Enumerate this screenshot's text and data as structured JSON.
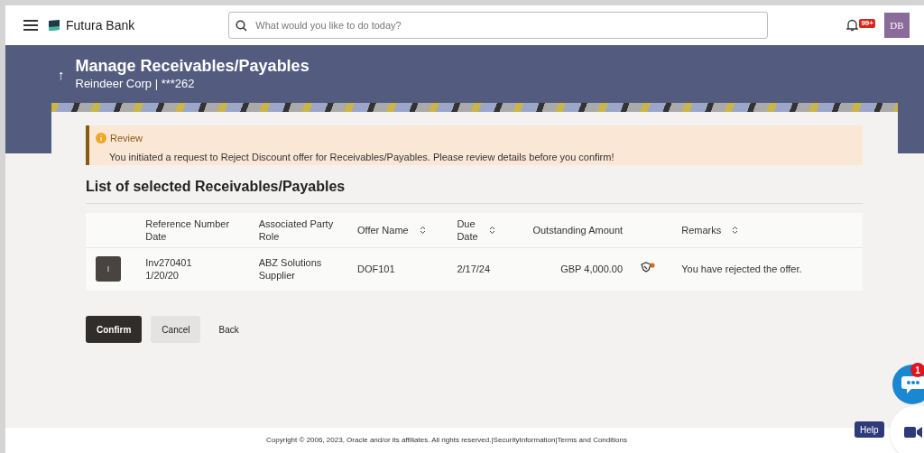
{
  "header": {
    "brand": "Futura Bank",
    "search": {
      "placeholder": "What would you like to do today?"
    },
    "notification_badge": "99+",
    "avatar": "DB"
  },
  "banner": {
    "back_arrow": "↑",
    "title": "Manage Receivables/Payables",
    "subtitle": "Reindeer Corp | ***262"
  },
  "review": {
    "title": "Review",
    "message": "You initiated a request to Reject Discount offer for Receivables/Payables. Please review details before you confirm!"
  },
  "section_title": "List of selected Receivables/Payables",
  "table": {
    "columns": [
      {
        "lines": [
          "Reference Number",
          "Date"
        ],
        "sortable": false
      },
      {
        "lines": [
          "Associated Party",
          "Role"
        ],
        "sortable": false
      },
      {
        "lines": [
          "Offer Name"
        ],
        "sortable": true
      },
      {
        "lines": [
          "Due",
          "Date"
        ],
        "sortable": true
      },
      {
        "lines": [
          "Outstanding Amount"
        ],
        "sortable": false
      },
      {
        "lines": [
          "Remarks"
        ],
        "sortable": true
      }
    ],
    "rows": [
      {
        "thumbnail": "I",
        "reference": [
          "Inv270401",
          "1/20/20"
        ],
        "party": [
          "ABZ Solutions",
          "Supplier"
        ],
        "offer": "DOF101",
        "due": "2/17/24",
        "amount": "GBP 4,000.00",
        "offer_tag": true,
        "remarks": "You have rejected the offer."
      }
    ]
  },
  "buttons": [
    {
      "label": "Confirm",
      "kind": "primary"
    },
    {
      "label": "Cancel",
      "kind": "secondary"
    },
    {
      "label": "Back",
      "kind": "link"
    }
  ],
  "footer": {
    "copyright": "Copyright © 2006, 2023, Oracle and/or its affiliates. All rights reserved.",
    "separator": "|",
    "links": [
      "SecurityInformation",
      "Terms and Conditions"
    ]
  },
  "chat": {
    "badge": "1"
  },
  "help": "Help"
}
